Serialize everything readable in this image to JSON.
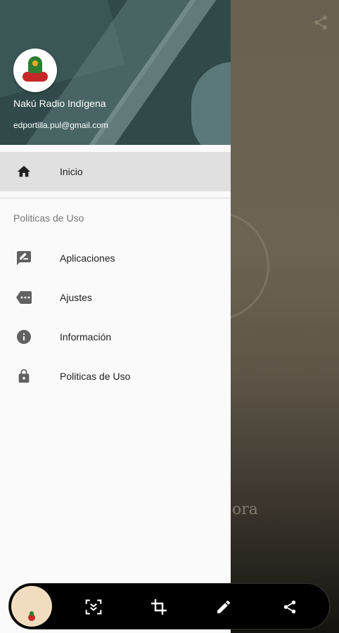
{
  "drawer": {
    "user_name": "Nakú Radio Indígena",
    "user_email": "edportilla.pul@gmail.com",
    "primary_item": {
      "label": "Inicio",
      "icon": "home-icon"
    },
    "section_title": "Politicas de Uso",
    "items": [
      {
        "label": "Aplicaciones",
        "icon": "rate-review-icon"
      },
      {
        "label": "Ajustes",
        "icon": "label-dots-icon"
      },
      {
        "label": "Información",
        "icon": "info-icon"
      },
      {
        "label": "Politicas de Uso",
        "icon": "lock-icon"
      }
    ]
  },
  "background": {
    "partial_text": "ora"
  },
  "screenshot_toolbar": {
    "tools": [
      "scroll-capture-icon",
      "crop-icon",
      "edit-icon",
      "share-icon"
    ]
  },
  "colors": {
    "header_bg": "#2f4a49",
    "active_item_bg": "#e0e0e0",
    "drawer_bg": "#fafafa",
    "toolbar_bg": "#000000"
  }
}
